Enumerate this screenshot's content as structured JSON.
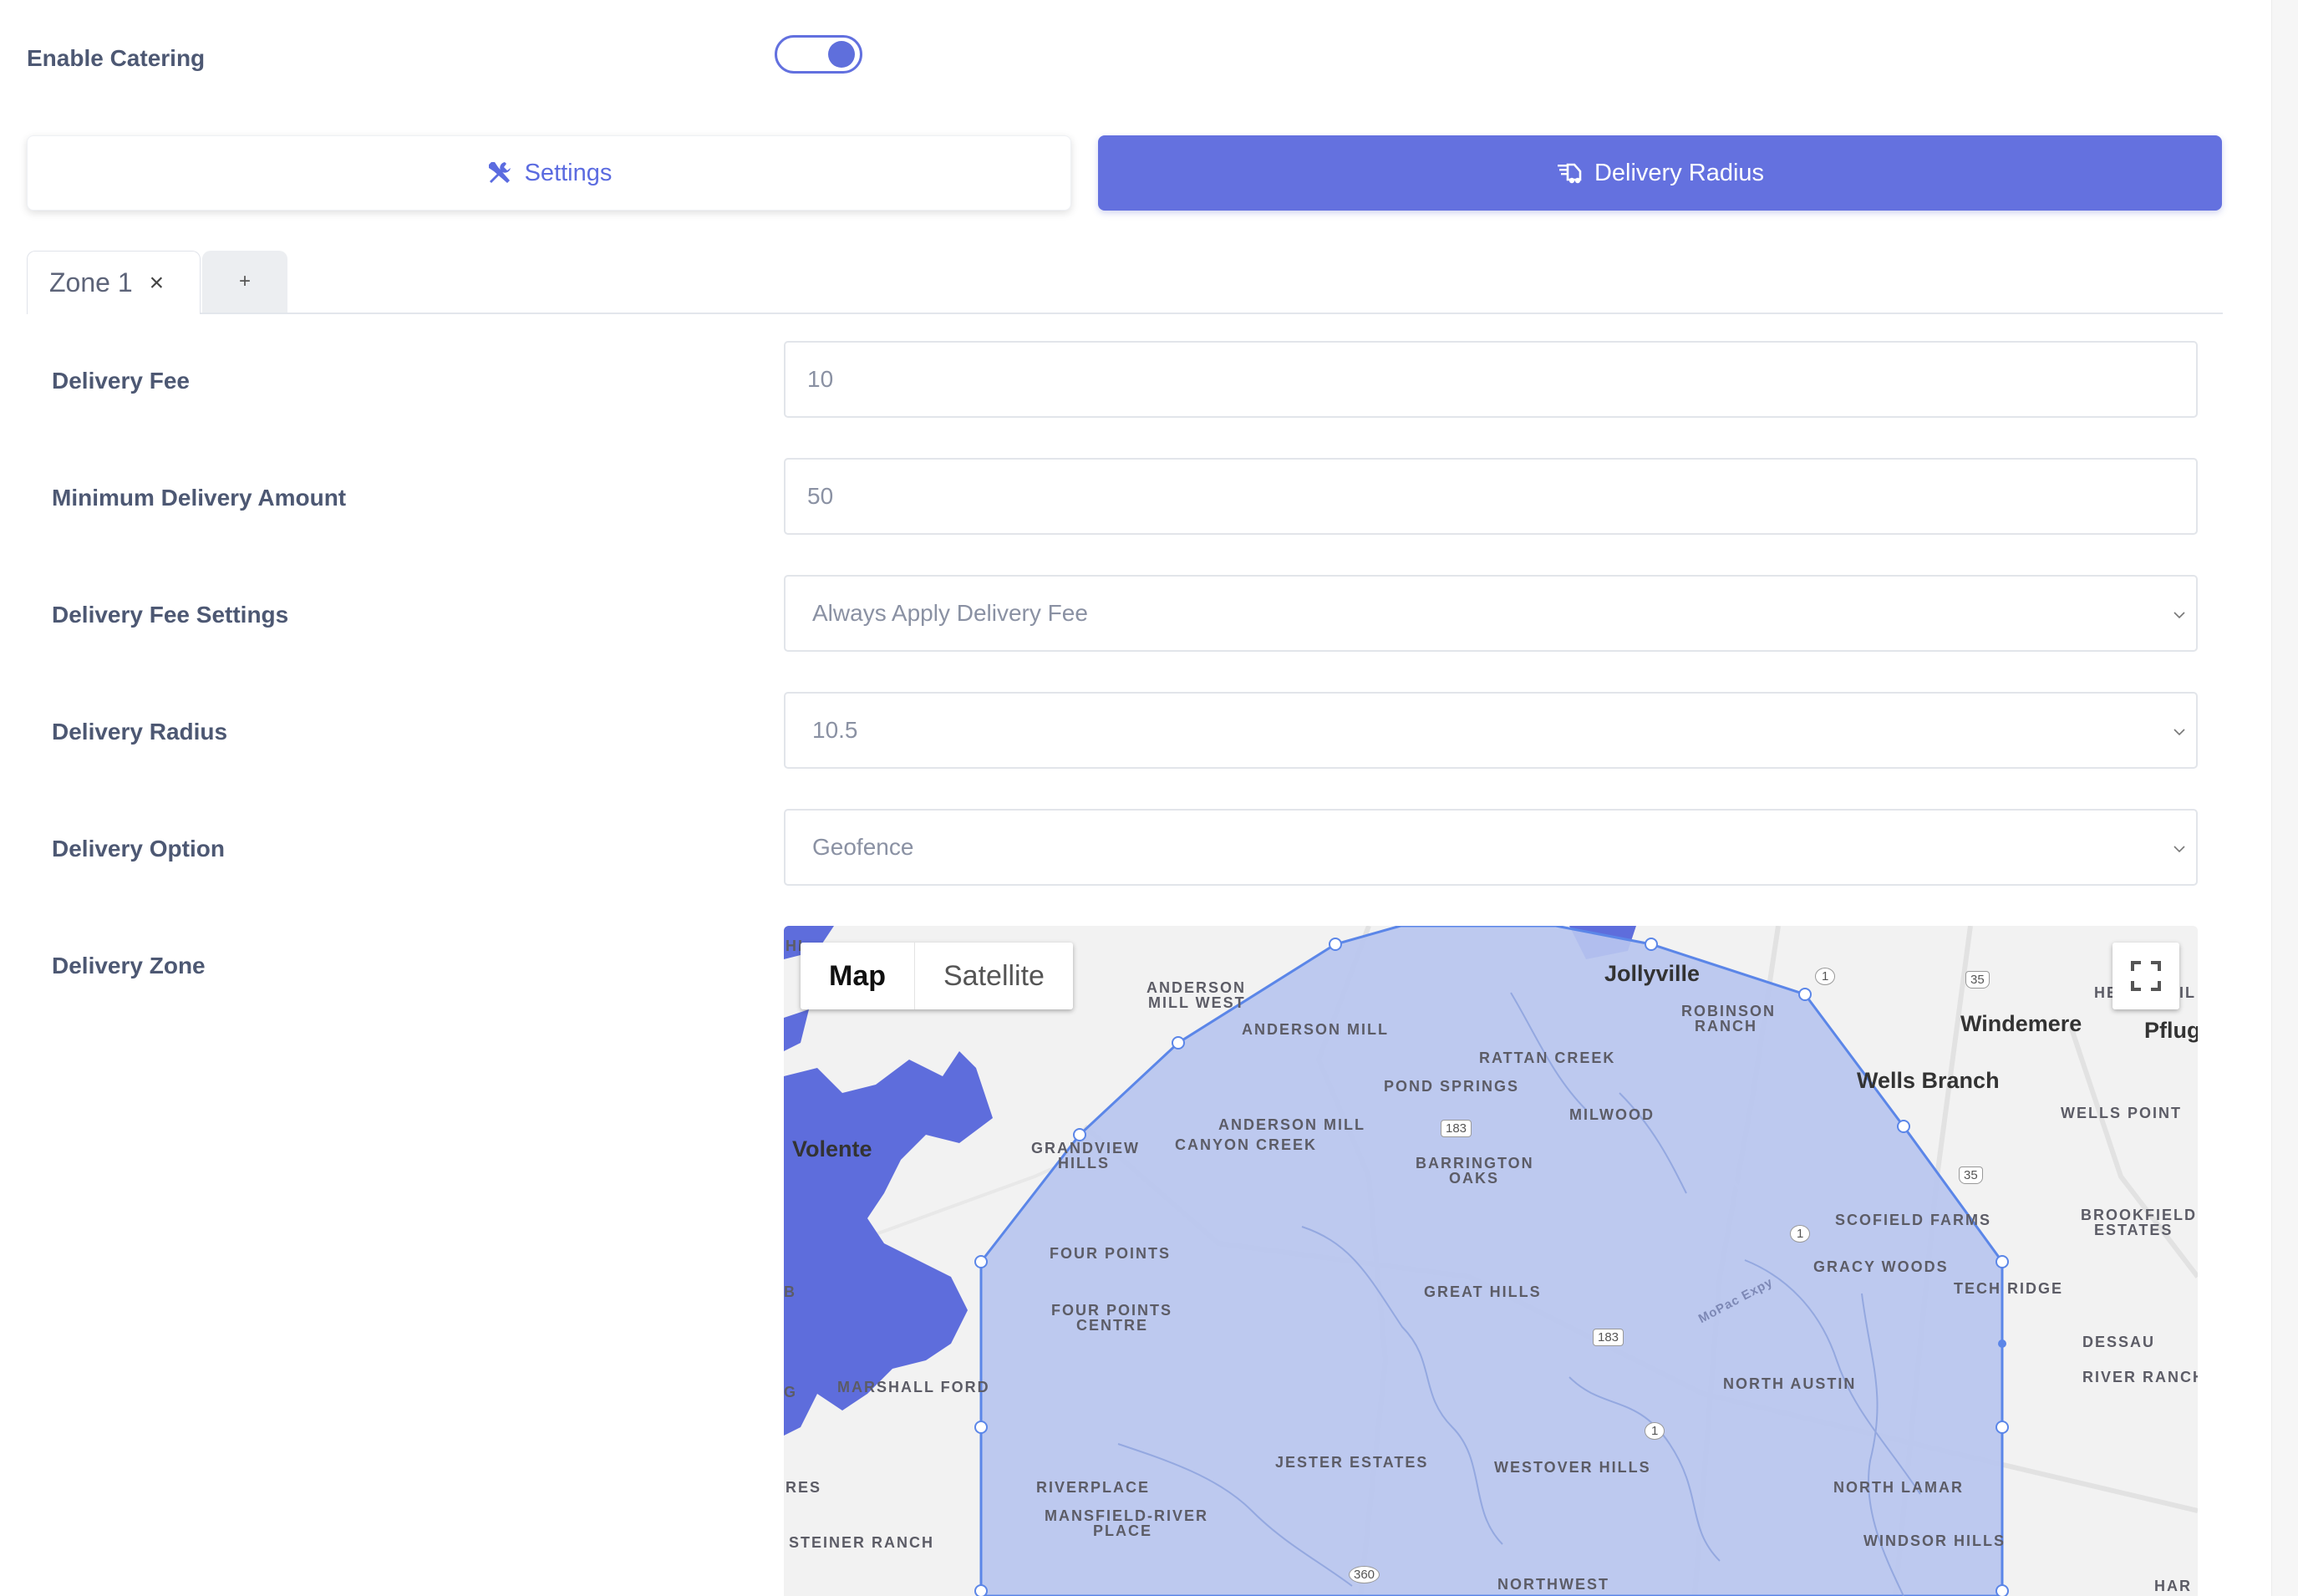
{
  "catering": {
    "label": "Enable Catering",
    "enabled": true
  },
  "tabs": {
    "settings_label": "Settings",
    "delivery_label": "Delivery Radius",
    "active": "Delivery Radius"
  },
  "zones": {
    "tab_label": "Zone 1",
    "close_glyph": "×",
    "add_glyph": "+"
  },
  "form": {
    "delivery_fee": {
      "label": "Delivery Fee",
      "value": "10"
    },
    "min_amount": {
      "label": "Minimum Delivery Amount",
      "value": "50"
    },
    "fee_settings": {
      "label": "Delivery Fee Settings",
      "value": "Always Apply Delivery Fee"
    },
    "radius": {
      "label": "Delivery Radius",
      "value": "10.5"
    },
    "option": {
      "label": "Delivery Option",
      "value": "Geofence"
    },
    "zone": {
      "label": "Delivery Zone"
    }
  },
  "map": {
    "type_map": "Map",
    "type_satellite": "Satellite",
    "labels": {
      "jollyville": "Jollyville",
      "windemere": "Windemere",
      "pflug": "Pflug",
      "wells_branch": "Wells Branch",
      "volente": "Volente",
      "anderson_mill_west_1": "ANDERSON",
      "anderson_mill_west_2": "MILL WEST",
      "anderson_mill": "ANDERSON MILL",
      "robinson_1": "ROBINSON",
      "robinson_2": "RANCH",
      "rattan_creek": "RATTAN CREEK",
      "pond_springs": "POND SPRINGS",
      "milwood": "MILWOOD",
      "wells_point": "WELLS POINT",
      "am_canyon_1": "ANDERSON MILL",
      "am_canyon_2": "CANYON CREEK",
      "grandview_1": "GRANDVIEW",
      "grandview_2": "HILLS",
      "barrington_1": "BARRINGTON",
      "barrington_2": "OAKS",
      "scofield": "SCOFIELD FARMS",
      "brookfield_1": "BROOKFIELD",
      "brookfield_2": "ESTATES",
      "four_points": "FOUR POINTS",
      "gracy_woods": "GRACY WOODS",
      "great_hills": "GREAT HILLS",
      "tech_ridge": "TECH RIDGE",
      "fp_centre_1": "FOUR POINTS",
      "fp_centre_2": "CENTRE",
      "dessau": "DESSAU",
      "river_ranch": "RIVER RANCH",
      "marshall_ford": "MARSHALL FORD",
      "north_austin": "NORTH AUSTIN",
      "jester_estates": "JESTER ESTATES",
      "westover_hills": "WESTOVER HILLS",
      "riverplace": "RIVERPLACE",
      "mansfield_1": "MANSFIELD-RIVER",
      "mansfield_2": "PLACE",
      "north_lamar": "NORTH LAMAR",
      "res": "RES",
      "windsor_hills": "WINDSOR HILLS",
      "steiner_ranch": "STEINER RANCH",
      "northwest": "NORTHWEST",
      "har": "HAR",
      "he": "HE",
      "vil": "VIL",
      "hi": "HI",
      "b": "B",
      "g": "G",
      "mopac": "MoPac Expy"
    },
    "shields": {
      "s183a": "183",
      "s183b": "183",
      "s1a": "1",
      "s1b": "1",
      "s1c": "1",
      "s35a": "35",
      "s35b": "35",
      "s360": "360"
    },
    "colors": {
      "polygon_fill": "#b9c6ef",
      "polygon_stroke": "#5b86e8",
      "water": "#5e6ddc"
    }
  }
}
